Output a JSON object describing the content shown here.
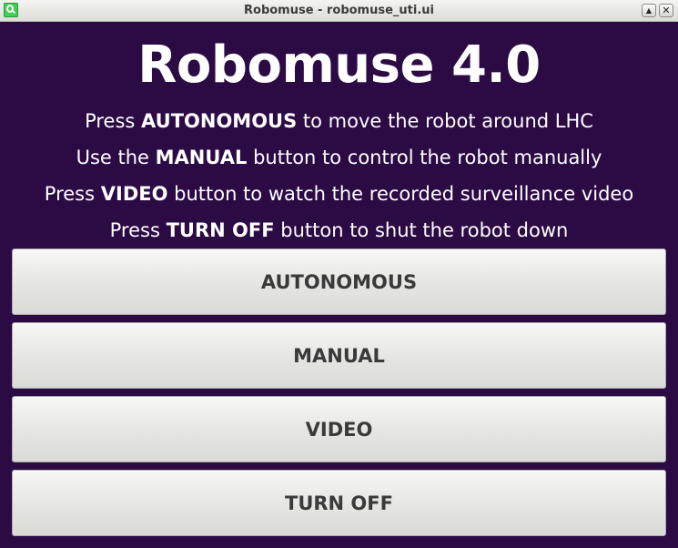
{
  "window": {
    "title": "Robomuse - robomuse_uti.ui",
    "app_icon": "qt-icon",
    "controls": {
      "maximize_glyph": "▲",
      "close_glyph": "✕"
    }
  },
  "main": {
    "heading": "Robomuse 4.0",
    "instructions": [
      {
        "before": "Press ",
        "bold": "AUTONOMOUS",
        "after": " to move the robot around LHC"
      },
      {
        "before": "Use the ",
        "bold": "MANUAL",
        "after": " button to control the robot manually"
      },
      {
        "before": "Press ",
        "bold": "VIDEO",
        "after": " button to watch the recorded surveillance video"
      },
      {
        "before": "Press ",
        "bold": "TURN OFF",
        "after": " button to shut the robot down"
      }
    ],
    "buttons": [
      {
        "label": "AUTONOMOUS"
      },
      {
        "label": "MANUAL"
      },
      {
        "label": "VIDEO"
      },
      {
        "label": "TURN OFF"
      }
    ]
  },
  "colors": {
    "background": "#2c0a44",
    "text": "#ffffff",
    "button_text": "#3a3a3a"
  }
}
